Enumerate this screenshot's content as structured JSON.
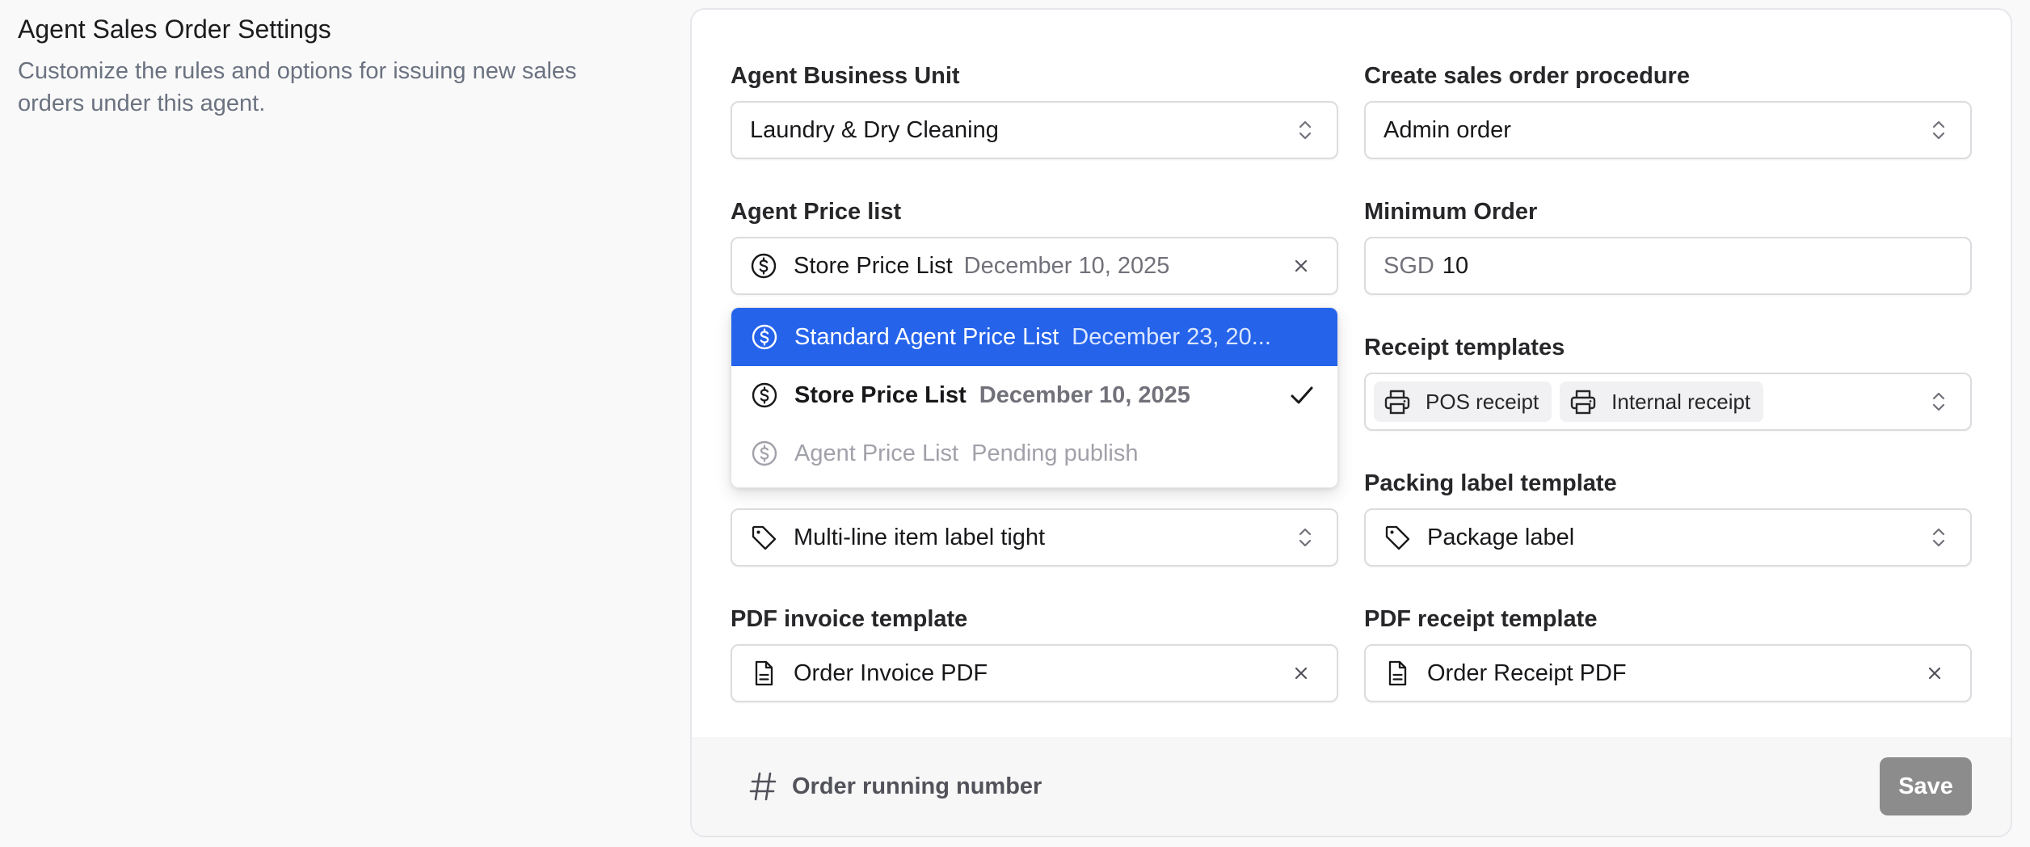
{
  "intro": {
    "title": "Agent Sales Order Settings",
    "description": "Customize the rules and options for issuing new sales orders under this agent."
  },
  "fields": {
    "business_unit": {
      "label": "Agent Business Unit",
      "value": "Laundry & Dry Cleaning"
    },
    "procedure": {
      "label": "Create sales order procedure",
      "value": "Admin order"
    },
    "price_list": {
      "label": "Agent Price list",
      "value": "Store Price List",
      "date": "December 10, 2025"
    },
    "minimum_order": {
      "label": "Minimum Order",
      "currency": "SGD",
      "value": "10"
    },
    "receipt_templates": {
      "label": "Receipt templates",
      "chips": [
        "POS receipt",
        "Internal receipt"
      ]
    },
    "item_label": {
      "value": "Multi-line item label tight"
    },
    "packing_label": {
      "label": "Packing label template",
      "value": "Package label"
    },
    "pdf_invoice": {
      "label": "PDF invoice template",
      "value": "Order Invoice PDF"
    },
    "pdf_receipt": {
      "label": "PDF receipt template",
      "value": "Order Receipt PDF"
    }
  },
  "price_list_dropdown": {
    "options": [
      {
        "name": "Standard Agent Price List",
        "date": "December 23, 20...",
        "state": "highlighted"
      },
      {
        "name": "Store Price List",
        "date": "December 10, 2025",
        "state": "selected"
      },
      {
        "name": "Agent Price List",
        "date": "Pending publish",
        "state": "disabled"
      }
    ]
  },
  "footer": {
    "running_number_label": "Order running number",
    "save_label": "Save"
  },
  "colors": {
    "accent": "#2563eb",
    "save_disabled": "#8c8c8c",
    "muted_text": "#71717a"
  },
  "icons": {
    "chevron": "chevron-up-down-icon",
    "dollar": "dollar-circle-icon",
    "close": "close-icon",
    "printer": "printer-icon",
    "tag": "tag-icon",
    "file": "file-text-icon",
    "check": "check-icon",
    "hash": "hash-icon"
  }
}
